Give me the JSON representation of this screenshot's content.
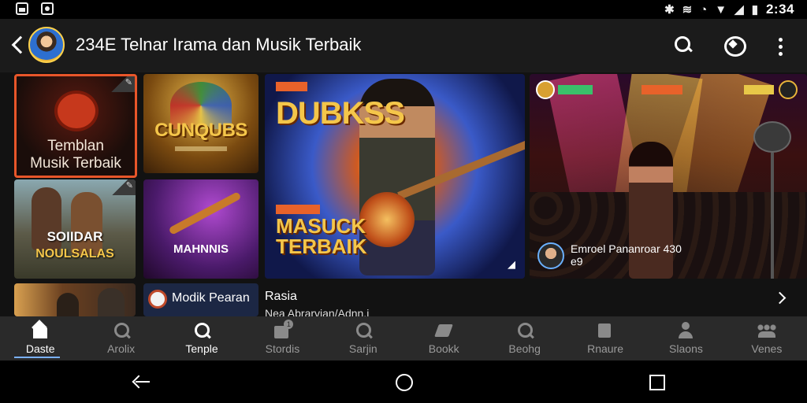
{
  "status_bar": {
    "time": "2:34",
    "icons": [
      "gallery-icon",
      "notification-icon",
      "bluetooth-icon",
      "vibrate-icon",
      "alarm-icon",
      "wifi-icon",
      "signal-icon",
      "battery-icon"
    ]
  },
  "app_bar": {
    "title": "234E Telnar Irama dan Musik Terbaik"
  },
  "tiles": {
    "t1": {
      "line1": "Temblan",
      "line2": "Musik Terbaik"
    },
    "t2": {
      "title": "CUNQUBS"
    },
    "t3": {
      "line1": "SOIIDAR",
      "line2": "NOULSALAS"
    },
    "t4": {
      "title": "MAHNNIS"
    },
    "t5": {
      "title": "DUBKSS",
      "subtitle_line1": "MASUCK",
      "subtitle_line2": "TERBAIK"
    },
    "t6": {
      "caption_line1": "Emroel Pananroar 430",
      "caption_line2": "e9"
    }
  },
  "row2": {
    "mini_label": "Modik Pearan",
    "title": "Rasia",
    "subtitle": "Nea Abrarvian/Adnn.i"
  },
  "bottom_nav": [
    {
      "label": "Daste",
      "active": true
    },
    {
      "label": "Arolix"
    },
    {
      "label": "Tenple",
      "highlight": true
    },
    {
      "label": "Stordis"
    },
    {
      "label": "Sarjin"
    },
    {
      "label": "Bookk"
    },
    {
      "label": "Beohg"
    },
    {
      "label": "Rnaure"
    },
    {
      "label": "Slaons"
    },
    {
      "label": "Venes"
    }
  ]
}
